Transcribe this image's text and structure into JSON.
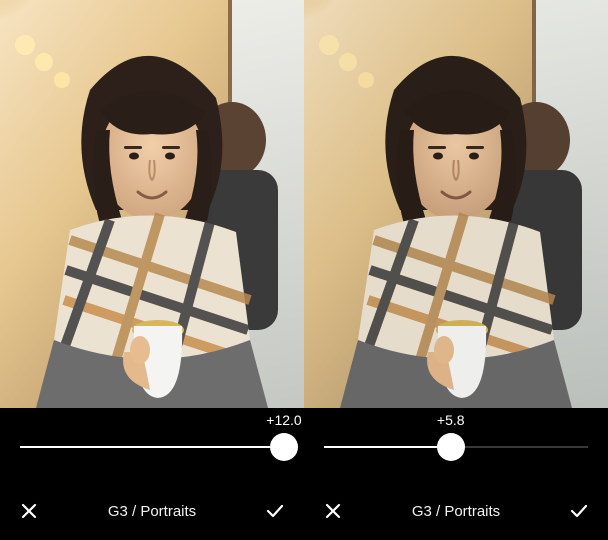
{
  "panels": [
    {
      "preset_label": "G3 / Portraits",
      "slider": {
        "value_text": "+12.0",
        "percent": 100
      },
      "icons": {
        "cancel": "close-icon",
        "confirm": "check-icon"
      }
    },
    {
      "preset_label": "G3 / Portraits",
      "slider": {
        "value_text": "+5.8",
        "percent": 48
      },
      "icons": {
        "cancel": "close-icon",
        "confirm": "check-icon"
      }
    }
  ],
  "colors": {
    "accent": "#ffffff",
    "bg": "#000000"
  }
}
